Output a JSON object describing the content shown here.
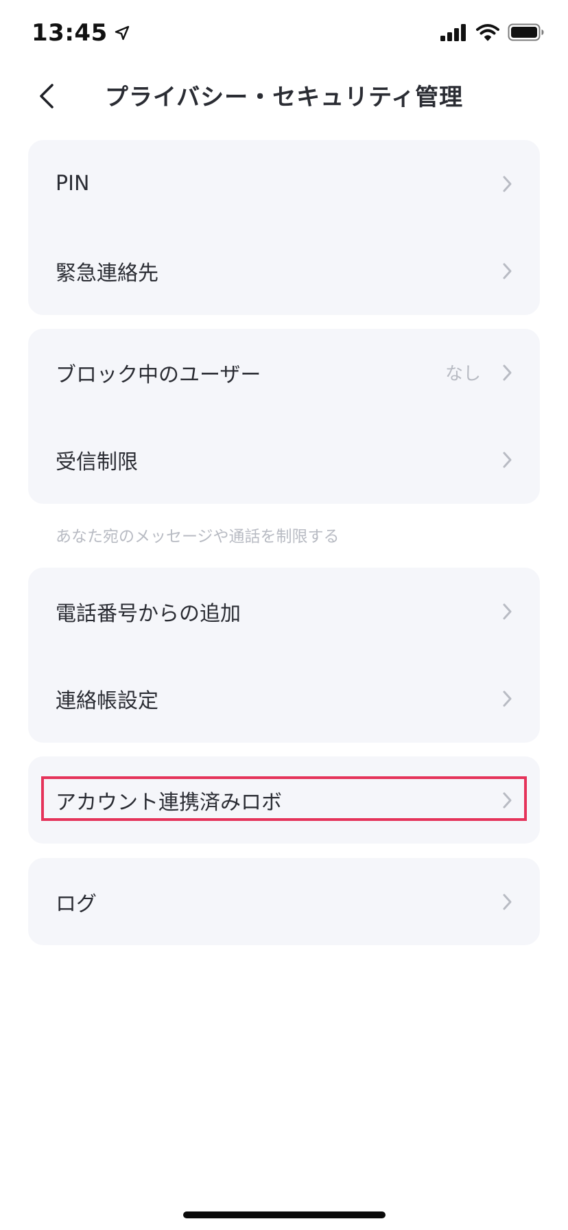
{
  "status_bar": {
    "time": "13:45",
    "icons": [
      "location-arrow-icon",
      "cellular-signal-icon",
      "wifi-icon",
      "battery-icon"
    ]
  },
  "header": {
    "title": "プライバシー・セキュリティ管理",
    "back_icon": "chevron-left-icon"
  },
  "sections": {
    "security": {
      "items": [
        {
          "label": "PIN"
        },
        {
          "label": "緊急連絡先"
        }
      ]
    },
    "blocking": {
      "items": [
        {
          "label": "ブロック中のユーザー",
          "value": "なし"
        },
        {
          "label": "受信制限"
        }
      ],
      "note": "あなた宛のメッセージや通話を制限する"
    },
    "contacts": {
      "items": [
        {
          "label": "電話番号からの追加"
        },
        {
          "label": "連絡帳設定"
        }
      ]
    },
    "robots": {
      "items": [
        {
          "label": "アカウント連携済みロボ"
        }
      ]
    },
    "logs": {
      "items": [
        {
          "label": "ログ"
        }
      ]
    }
  },
  "colors": {
    "card_background": "#f5f6fa",
    "highlight": "#e5335a",
    "muted_text": "#b8bbc3",
    "primary_text": "#2a2c33"
  }
}
